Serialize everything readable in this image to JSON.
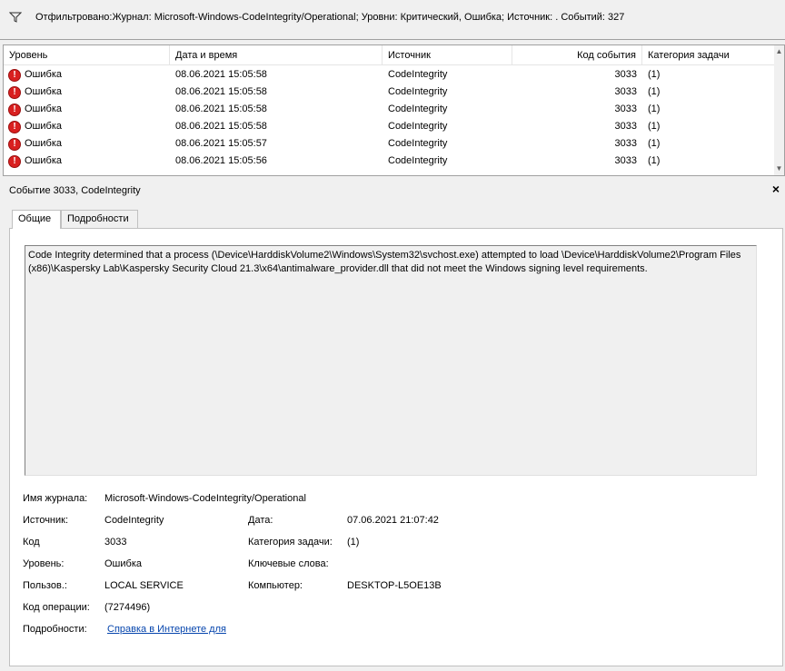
{
  "filter": {
    "text": "Отфильтровано:Журнал: Microsoft-Windows-CodeIntegrity/Operational; Уровни: Критический, Ошибка; Источник: . Событий: 327"
  },
  "columns": {
    "level": "Уровень",
    "datetime": "Дата и время",
    "source": "Источник",
    "event_id": "Код события",
    "task_category": "Категория задачи"
  },
  "rows": [
    {
      "level": "Ошибка",
      "datetime": "08.06.2021 15:05:58",
      "source": "CodeIntegrity",
      "event_id": "3033",
      "task_category": "(1)"
    },
    {
      "level": "Ошибка",
      "datetime": "08.06.2021 15:05:58",
      "source": "CodeIntegrity",
      "event_id": "3033",
      "task_category": "(1)"
    },
    {
      "level": "Ошибка",
      "datetime": "08.06.2021 15:05:58",
      "source": "CodeIntegrity",
      "event_id": "3033",
      "task_category": "(1)"
    },
    {
      "level": "Ошибка",
      "datetime": "08.06.2021 15:05:58",
      "source": "CodeIntegrity",
      "event_id": "3033",
      "task_category": "(1)"
    },
    {
      "level": "Ошибка",
      "datetime": "08.06.2021 15:05:57",
      "source": "CodeIntegrity",
      "event_id": "3033",
      "task_category": "(1)"
    },
    {
      "level": "Ошибка",
      "datetime": "08.06.2021 15:05:56",
      "source": "CodeIntegrity",
      "event_id": "3033",
      "task_category": "(1)"
    }
  ],
  "detail": {
    "title": "Событие 3033, CodeIntegrity",
    "close": "×",
    "tabs": [
      "Общие",
      "Подробности"
    ],
    "message": "Code Integrity determined that a process (\\Device\\HarddiskVolume2\\Windows\\System32\\svchost.exe) attempted to load \\Device\\HarddiskVolume2\\Program Files (x86)\\Kaspersky Lab\\Kaspersky Security Cloud 21.3\\x64\\antimalware_provider.dll that did not meet the Windows signing level requirements.",
    "fields": {
      "log_name_label": "Имя журнала:",
      "log_name_value": "Microsoft-Windows-CodeIntegrity/Operational",
      "source_label": "Источник:",
      "source_value": "CodeIntegrity",
      "date_label": "Дата:",
      "date_value": "07.06.2021 21:07:42",
      "code_label": "Код",
      "code_value": "3033",
      "task_label": "Категория задачи:",
      "task_value": "(1)",
      "level_label": "Уровень:",
      "level_value": "Ошибка",
      "keywords_label": "Ключевые слова:",
      "keywords_value": "",
      "user_label": "Пользов.:",
      "user_value": "LOCAL SERVICE",
      "computer_label": "Компьютер:",
      "computer_value": "DESKTOP-L5OE13B",
      "opcode_label": "Код операции:",
      "opcode_value": "(7274496)",
      "more_label": "Подробности:",
      "more_link": "Справка в Интернете для"
    }
  },
  "icons": {
    "filter": "funnel-icon",
    "error": "error-icon",
    "close": "close-icon"
  },
  "colors": {
    "error_red": "#d92020",
    "link_blue": "#0645ad"
  }
}
